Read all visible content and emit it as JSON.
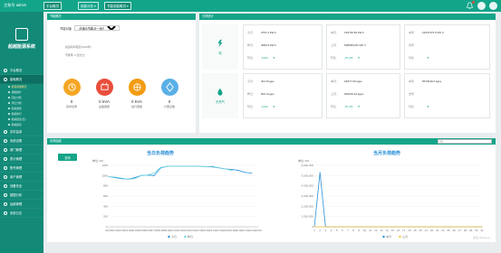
{
  "topbar": {
    "user": "主账号 admin",
    "tabs": [
      {
        "label": "平台概况",
        "active": true
      },
      {
        "label": "用能分析 ▾",
        "active": false
      },
      {
        "label": "节能用能概况 ▾",
        "active": true
      }
    ],
    "icons": [
      "bell-icon",
      "avatar-icon",
      "settings-icon"
    ]
  },
  "sidebar": {
    "brand": "超越能源系统",
    "items": [
      {
        "label": "平台概况",
        "icon": "home-icon"
      },
      {
        "label": "能耗概况",
        "icon": "gauge-icon",
        "active": true
      }
    ],
    "subitems": [
      {
        "label": "能源用量概况",
        "active": true
      },
      {
        "label": "用能统计"
      },
      {
        "label": "同比分析"
      },
      {
        "label": "环比分析"
      },
      {
        "label": "能耗趋势"
      },
      {
        "label": "能耗排行"
      },
      {
        "label": "能耗报表(日)"
      },
      {
        "label": "能耗报表"
      }
    ],
    "items2": [
      {
        "label": "实时监测",
        "icon": "monitor-icon"
      },
      {
        "label": "系统设置",
        "icon": "gear-icon"
      },
      {
        "label": "部门管理",
        "icon": "org-icon"
      },
      {
        "label": "表计管理",
        "icon": "meter-icon"
      },
      {
        "label": "账号管理",
        "icon": "user-icon"
      },
      {
        "label": "用户管理",
        "icon": "users-icon"
      },
      {
        "label": "设备安全",
        "icon": "shield-icon"
      },
      {
        "label": "数据分析",
        "icon": "chart-icon"
      },
      {
        "label": "运维管理",
        "icon": "wrench-icon"
      },
      {
        "label": "系统日志",
        "icon": "log-icon"
      }
    ]
  },
  "overview": {
    "title": "节能概况",
    "select_label": "节能对象",
    "select_value": "此演示节能点一运行中的",
    "meta1": "投运时间待定(2019年)",
    "meta2": "节能率: 0 百分比",
    "kpis": [
      {
        "value": "0",
        "label": "实时功率",
        "color": "#f5a623"
      },
      {
        "value": "0 kVA",
        "label": "设备容量",
        "color": "#ea4e3c"
      },
      {
        "value": "0 kVA",
        "label": "运行容量",
        "color": "#f39c12"
      },
      {
        "value": "0",
        "label": "计量点数",
        "color": "#5ab0e6"
      }
    ]
  },
  "stats": {
    "title": "分项统计",
    "rows": [
      {
        "name": "电",
        "icon": "lightning-icon",
        "boxes": [
          [
            {
              "k": "今日:",
              "v": "3757.2 kW h"
            },
            {
              "k": "昨日:",
              "v": "4084.6 kW h"
            },
            {
              "k": "环比:",
              "v": "-0.0%",
              "g": true
            }
          ],
          [
            {
              "k": "本月:",
              "v": "135730.81 kW h"
            },
            {
              "k": "上月:",
              "v": "5281804.81 kW h"
            },
            {
              "k": "环比:",
              "v": "-97.4%",
              "g": true
            }
          ],
          [
            {
              "k": "本年:",
              "v": "15247474.5 kW h"
            },
            {
              "k": "去年:",
              "v": ""
            },
            {
              "k": "同比:",
              "v": ""
            }
          ]
        ]
      },
      {
        "name": "天然气",
        "icon": "gas-icon",
        "boxes": [
          [
            {
              "k": "今日:",
              "v": "401.8 kgce"
            },
            {
              "k": "昨日:",
              "v": "502.0 kgce"
            },
            {
              "k": "环比:",
              "v": "-0.0%",
              "g": true
            }
          ],
          [
            {
              "k": "本月:",
              "v": "16677.63 kgce"
            },
            {
              "k": "上月:",
              "v": "649146.10 kgce"
            },
            {
              "k": "环比:",
              "v": "-97.4%",
              "g": true
            }
          ],
          [
            {
              "k": "本年:",
              "v": "5573916.0 kgce"
            },
            {
              "k": "去年:",
              "v": ""
            },
            {
              "k": "同比:",
              "v": ""
            }
          ]
        ]
      }
    ]
  },
  "curve": {
    "title": "负荷曲线",
    "search_placeholder": "日",
    "query_label": "查询",
    "watermark": "激活 Windows"
  },
  "chart_data": [
    {
      "type": "line",
      "title": "当日负荷趋势",
      "ylabel": "单位: kW",
      "ylim": [
        0,
        1200
      ],
      "x": [
        "00:00",
        "01:00",
        "02:00",
        "03:00",
        "04:00",
        "05:00",
        "06:00",
        "07:00",
        "08:00",
        "09:00",
        "10:00",
        "11:00",
        "12:00",
        "13:00",
        "14:00",
        "15:00",
        "16:00",
        "17:00",
        "18:00",
        "19:00",
        "20:00",
        "21:00",
        "22:00",
        "23:00"
      ],
      "series": [
        {
          "name": "今日",
          "color": "#2b8fd8",
          "values": [
            980,
            960,
            940,
            930,
            960,
            1000,
            1010,
            1000,
            1150,
            1180,
            1180,
            1180,
            1180,
            1180,
            1180,
            1175,
            1170,
            1150,
            1130,
            1120,
            1100,
            1060,
            1050,
            null
          ]
        },
        {
          "name": "昨日",
          "color": "#6fd3e0",
          "values": [
            980,
            970,
            950,
            930,
            940,
            1000,
            1010,
            1050,
            1160,
            1180,
            1180,
            1180,
            1180,
            1180,
            1180,
            1175,
            1180,
            1150,
            1130,
            1100,
            null,
            null,
            null,
            null
          ]
        }
      ]
    },
    {
      "type": "line",
      "title": "当月负荷趋势",
      "ylabel": "单位: kW",
      "ylim": [
        0,
        6000000
      ],
      "x": [
        "1",
        "2",
        "3",
        "4",
        "5",
        "6",
        "7",
        "8",
        "9",
        "10",
        "11",
        "12",
        "13",
        "14",
        "15",
        "16",
        "17",
        "18",
        "19",
        "20",
        "21",
        "22",
        "23",
        "24",
        "25",
        "26",
        "27",
        "28",
        "29",
        "30",
        "31"
      ],
      "series": [
        {
          "name": "本月",
          "color": "#2b8fd8",
          "values": [
            0,
            5300000,
            0,
            0,
            0,
            0,
            0,
            0,
            0,
            0,
            0,
            0,
            0,
            0,
            0,
            0,
            0,
            0,
            0,
            0,
            0,
            0,
            0,
            0,
            0,
            0,
            0,
            0,
            0,
            0,
            0
          ]
        },
        {
          "name": "上月",
          "color": "#f5c542",
          "values": [
            0,
            0,
            0,
            0,
            0,
            0,
            0,
            0,
            0,
            0,
            0,
            0,
            0,
            0,
            0,
            0,
            0,
            0,
            0,
            0,
            0,
            0,
            0,
            0,
            0,
            0,
            0,
            0,
            0,
            0,
            0
          ]
        }
      ]
    }
  ]
}
